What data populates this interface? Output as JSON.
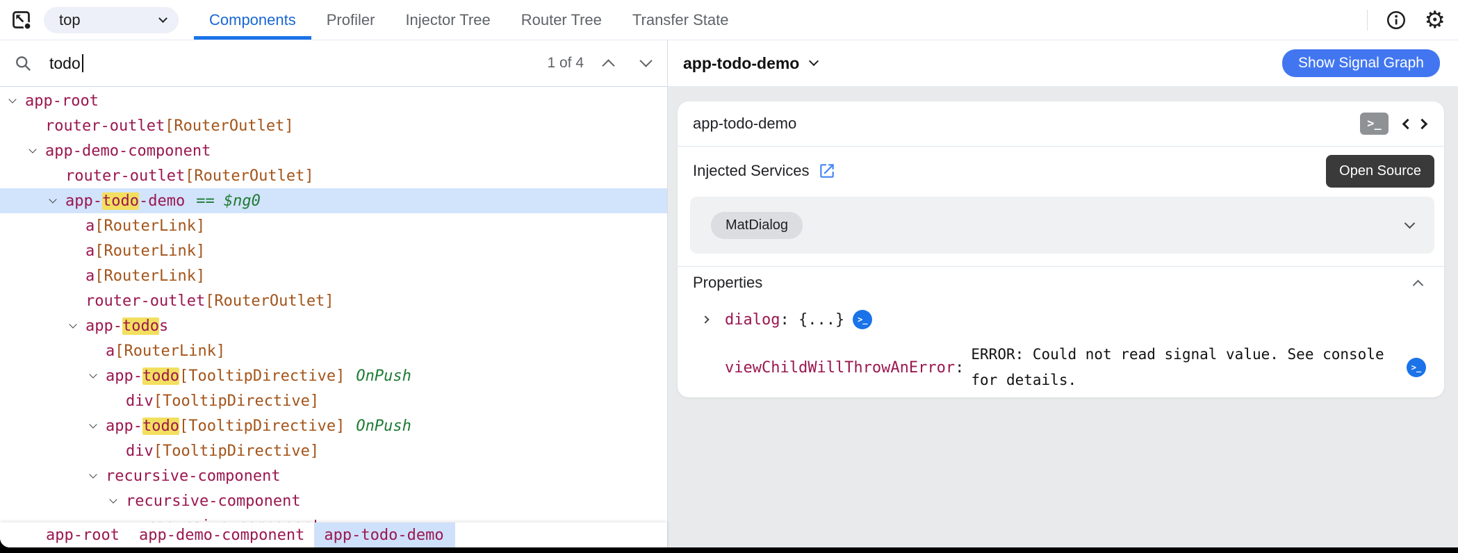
{
  "colors": {
    "accent_blue": "#1a73e8",
    "tab_active": "#1967d2",
    "element_name": "#9a1750",
    "directive_name": "#a3541a",
    "modifier_green": "#1e7b34",
    "match_highlight": "#f3df5f",
    "selected_row": "#d2e3fc",
    "breadcrumb_selected": "#cfe0fb",
    "signal_button_blue": "#4276f1",
    "open_source_bg": "#3a3a3a"
  },
  "toolbar": {
    "frame_selector": "top",
    "tabs": [
      {
        "label": "Components",
        "active": true
      },
      {
        "label": "Profiler",
        "active": false
      },
      {
        "label": "Injector Tree",
        "active": false
      },
      {
        "label": "Router Tree",
        "active": false
      },
      {
        "label": "Transfer State",
        "active": false
      }
    ]
  },
  "search": {
    "value": "todo",
    "results": "1 of 4"
  },
  "tree": {
    "rows": [
      {
        "level": 0,
        "expand": true,
        "parts": [
          {
            "t": "app-root"
          }
        ]
      },
      {
        "level": 1,
        "expand": false,
        "parts": [
          {
            "t": "router-outlet"
          }
        ],
        "dir": "[RouterOutlet]"
      },
      {
        "level": 1,
        "expand": true,
        "parts": [
          {
            "t": "app-demo-component"
          }
        ]
      },
      {
        "level": 2,
        "expand": false,
        "parts": [
          {
            "t": "router-outlet"
          }
        ],
        "dir": "[RouterOutlet]"
      },
      {
        "level": 2,
        "expand": true,
        "selected": true,
        "parts": [
          {
            "t": "app-"
          },
          {
            "t": "todo",
            "hl": true
          },
          {
            "t": "-demo"
          }
        ],
        "mod": "== $ng0"
      },
      {
        "level": 3,
        "expand": false,
        "parts": [
          {
            "t": "a"
          }
        ],
        "dir": "[RouterLink]"
      },
      {
        "level": 3,
        "expand": false,
        "parts": [
          {
            "t": "a"
          }
        ],
        "dir": "[RouterLink]"
      },
      {
        "level": 3,
        "expand": false,
        "parts": [
          {
            "t": "a"
          }
        ],
        "dir": "[RouterLink]"
      },
      {
        "level": 3,
        "expand": false,
        "parts": [
          {
            "t": "router-outlet"
          }
        ],
        "dir": "[RouterOutlet]"
      },
      {
        "level": 3,
        "expand": true,
        "parts": [
          {
            "t": "app-"
          },
          {
            "t": "todo",
            "hl": true
          },
          {
            "t": "s"
          }
        ]
      },
      {
        "level": 4,
        "expand": false,
        "parts": [
          {
            "t": "a"
          }
        ],
        "dir": "[RouterLink]"
      },
      {
        "level": 4,
        "expand": true,
        "parts": [
          {
            "t": "app-"
          },
          {
            "t": "todo",
            "hl": true
          }
        ],
        "dir": "[TooltipDirective]",
        "mod": "OnPush"
      },
      {
        "level": 5,
        "expand": false,
        "parts": [
          {
            "t": "div"
          }
        ],
        "dir": "[TooltipDirective]"
      },
      {
        "level": 4,
        "expand": true,
        "parts": [
          {
            "t": "app-"
          },
          {
            "t": "todo",
            "hl": true
          }
        ],
        "dir": "[TooltipDirective]",
        "mod": "OnPush"
      },
      {
        "level": 5,
        "expand": false,
        "parts": [
          {
            "t": "div"
          }
        ],
        "dir": "[TooltipDirective]"
      },
      {
        "level": 4,
        "expand": true,
        "parts": [
          {
            "t": "recursive-component"
          }
        ]
      },
      {
        "level": 5,
        "expand": true,
        "parts": [
          {
            "t": "recursive-component"
          }
        ]
      },
      {
        "level": 6,
        "expand": true,
        "parts": [
          {
            "t": "recursive-component"
          }
        ]
      }
    ]
  },
  "breadcrumbs": {
    "items": [
      {
        "label": "app-root",
        "selected": false
      },
      {
        "label": "app-demo-component",
        "selected": false
      },
      {
        "label": "app-todo-demo",
        "selected": true
      }
    ]
  },
  "details": {
    "selected_component": "app-todo-demo",
    "show_signal_graph_label": "Show Signal Graph",
    "card": {
      "title": "app-todo-demo",
      "injected_services_label": "Injected Services",
      "open_source_label": "Open Source",
      "services": [
        "MatDialog"
      ],
      "properties_label": "Properties",
      "properties": [
        {
          "name": "dialog",
          "punct": ": ",
          "value": "{...}"
        },
        {
          "name": "viewChildWillThrowAnError",
          "punct": ":",
          "error": "ERROR: Could not read signal value. See console for details."
        }
      ]
    }
  }
}
